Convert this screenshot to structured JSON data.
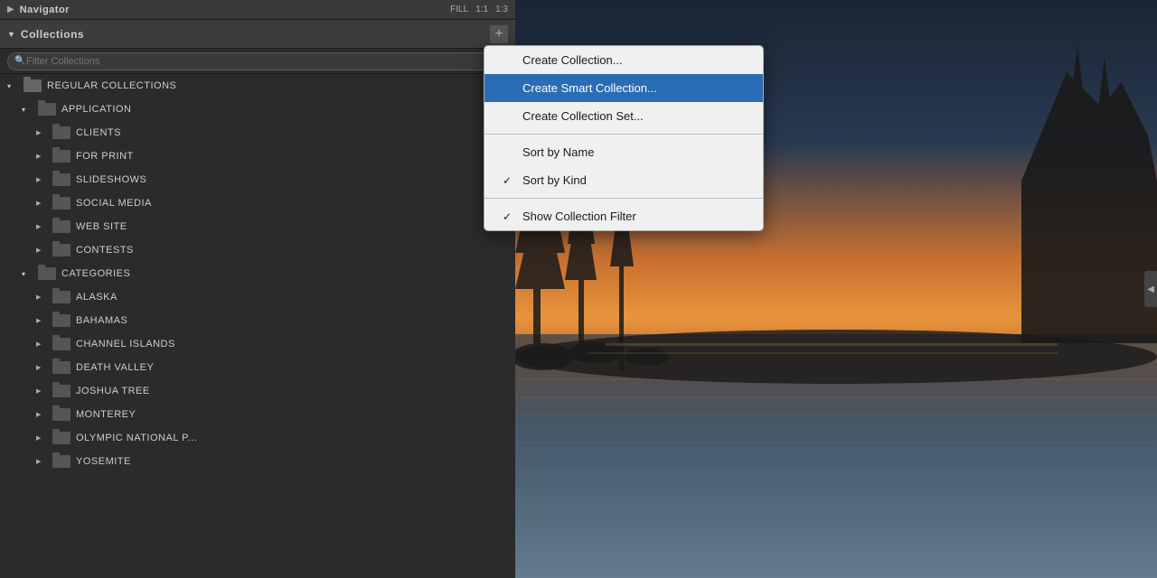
{
  "navigator": {
    "title": "Navigator",
    "controls": [
      "FILL",
      "1:1",
      "1:3"
    ]
  },
  "collections": {
    "title": "Collections",
    "plus_label": "+",
    "filter_placeholder": "Filter Collections"
  },
  "tree": {
    "items": [
      {
        "id": "regular-collections",
        "label": "REGULAR COLLECTIONS",
        "indent": 0,
        "arrow": "▾",
        "has_folder": true,
        "expanded": true
      },
      {
        "id": "application",
        "label": "APPLICATION",
        "indent": 1,
        "arrow": "▾",
        "has_folder": true,
        "expanded": true
      },
      {
        "id": "clients",
        "label": "CLIENTS",
        "indent": 2,
        "arrow": "▶",
        "has_folder": true,
        "expanded": false
      },
      {
        "id": "for-print",
        "label": "FOR PRINT",
        "indent": 2,
        "arrow": "▶",
        "has_folder": true,
        "expanded": false
      },
      {
        "id": "slideshows",
        "label": "SLIDESHOWS",
        "indent": 2,
        "arrow": "▶",
        "has_folder": true,
        "expanded": false
      },
      {
        "id": "social-media",
        "label": "SOCIAL MEDIA",
        "indent": 2,
        "arrow": "▶",
        "has_folder": true,
        "expanded": false
      },
      {
        "id": "web-site",
        "label": "WEB SITE",
        "indent": 2,
        "arrow": "▶",
        "has_folder": true,
        "expanded": false
      },
      {
        "id": "contests",
        "label": "CONTESTS",
        "indent": 2,
        "arrow": "▶",
        "has_folder": true,
        "expanded": false
      },
      {
        "id": "categories",
        "label": "CATEGORIES",
        "indent": 1,
        "arrow": "▾",
        "has_folder": true,
        "expanded": true
      },
      {
        "id": "alaska",
        "label": "ALASKA",
        "indent": 2,
        "arrow": "▶",
        "has_folder": true,
        "expanded": false
      },
      {
        "id": "bahamas",
        "label": "BAHAMAS",
        "indent": 2,
        "arrow": "▶",
        "has_folder": true,
        "expanded": false
      },
      {
        "id": "channel-islands",
        "label": "CHANNEL ISLANDS",
        "indent": 2,
        "arrow": "▶",
        "has_folder": true,
        "expanded": false
      },
      {
        "id": "death-valley",
        "label": "DEATH VALLEY",
        "indent": 2,
        "arrow": "▶",
        "has_folder": true,
        "expanded": false
      },
      {
        "id": "joshua-tree",
        "label": "JOSHUA TREE",
        "indent": 2,
        "arrow": "▶",
        "has_folder": true,
        "expanded": false
      },
      {
        "id": "monterey",
        "label": "MONTEREY",
        "indent": 2,
        "arrow": "▶",
        "has_folder": true,
        "expanded": false
      },
      {
        "id": "olympic-national",
        "label": "OLYMPIC NATIONAL P...",
        "indent": 2,
        "arrow": "▶",
        "has_folder": true,
        "expanded": false
      },
      {
        "id": "yosemite",
        "label": "YOSEMITE",
        "indent": 2,
        "arrow": "▶",
        "has_folder": true,
        "expanded": false
      }
    ]
  },
  "dropdown": {
    "items": [
      {
        "id": "create-collection",
        "label": "Create Collection...",
        "highlighted": false,
        "checkmark": ""
      },
      {
        "id": "create-smart-collection",
        "label": "Create Smart Collection...",
        "highlighted": true,
        "checkmark": ""
      },
      {
        "id": "create-collection-set",
        "label": "Create Collection Set...",
        "highlighted": false,
        "checkmark": ""
      },
      {
        "id": "sort-by-name",
        "label": "Sort by Name",
        "highlighted": false,
        "checkmark": ""
      },
      {
        "id": "sort-by-kind",
        "label": "Sort by Kind",
        "highlighted": false,
        "checkmark": "✓"
      },
      {
        "id": "show-collection-filter",
        "label": "Show Collection Filter",
        "highlighted": false,
        "checkmark": "✓"
      }
    ],
    "separator1_after": 2,
    "separator2_after": 3
  }
}
